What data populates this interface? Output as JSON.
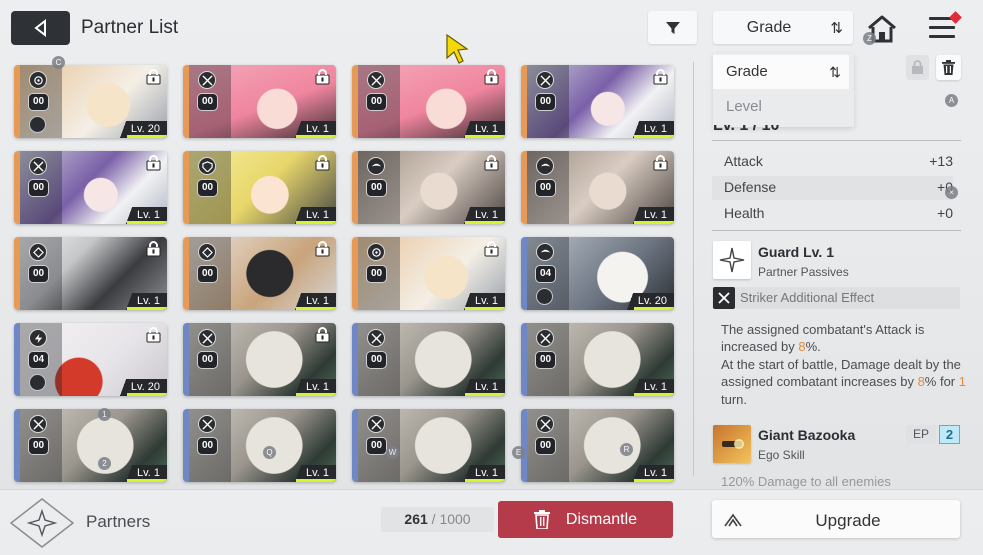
{
  "header": {
    "title": "Partner List",
    "sort_label": "Grade",
    "sort_arrows": "⇅",
    "hotkey_home": "Z"
  },
  "dropdown": {
    "options": [
      "Grade",
      "Level"
    ],
    "selected": "Grade",
    "hotkey": "A"
  },
  "grid": {
    "hotkey_top": "C",
    "cards": [
      {
        "count": "00",
        "level": "Lv. 20",
        "rarity": "orange",
        "type": "target",
        "art": "art1",
        "elem": true
      },
      {
        "count": "00",
        "level": "Lv. 1",
        "rarity": "orange",
        "type": "sword",
        "art": "art2",
        "elem": false
      },
      {
        "count": "00",
        "level": "Lv. 1",
        "rarity": "orange",
        "type": "sword",
        "art": "art2",
        "elem": false
      },
      {
        "count": "00",
        "level": "Lv. 1",
        "rarity": "orange",
        "type": "sword",
        "art": "art3",
        "elem": false
      },
      {
        "count": "00",
        "level": "Lv. 1",
        "rarity": "orange",
        "type": "sword",
        "art": "art3",
        "elem": false
      },
      {
        "count": "00",
        "level": "Lv. 1",
        "rarity": "orange",
        "type": "shield",
        "art": "art4",
        "elem": false
      },
      {
        "count": "00",
        "level": "Lv. 1",
        "rarity": "orange",
        "type": "wing",
        "art": "art5",
        "elem": false
      },
      {
        "count": "00",
        "level": "Lv. 1",
        "rarity": "orange",
        "type": "wing",
        "art": "art5",
        "elem": false
      },
      {
        "count": "00",
        "level": "Lv. 1",
        "rarity": "orange",
        "type": "diamond",
        "art": "art6",
        "elem": false
      },
      {
        "count": "00",
        "level": "Lv. 1",
        "rarity": "orange",
        "type": "diamond",
        "art": "art7",
        "elem": false
      },
      {
        "count": "00",
        "level": "Lv. 1",
        "rarity": "orange",
        "type": "target",
        "art": "art1",
        "elem": false
      },
      {
        "count": "04",
        "level": "Lv. 20",
        "rarity": "blue",
        "type": "wing",
        "art": "art8",
        "elem": true
      },
      {
        "count": "04",
        "level": "Lv. 20",
        "rarity": "blue",
        "type": "bolt",
        "art": "art9",
        "elem": true
      },
      {
        "count": "00",
        "level": "Lv. 1",
        "rarity": "blue",
        "type": "sword",
        "art": "art10",
        "elem": false
      },
      {
        "count": "00",
        "level": "Lv. 1",
        "rarity": "blue",
        "type": "sword",
        "art": "art10",
        "elem": false
      },
      {
        "count": "00",
        "level": "Lv. 1",
        "rarity": "blue",
        "type": "sword",
        "art": "art10",
        "elem": false
      },
      {
        "count": "00",
        "level": "Lv. 1",
        "rarity": "blue",
        "type": "sword",
        "art": "art10",
        "elem": false
      },
      {
        "count": "00",
        "level": "Lv. 1",
        "rarity": "blue",
        "type": "sword",
        "art": "art10",
        "elem": false
      },
      {
        "count": "00",
        "level": "Lv. 1",
        "rarity": "blue",
        "type": "sword",
        "art": "art10",
        "elem": false
      },
      {
        "count": "00",
        "level": "Lv. 1",
        "rarity": "blue",
        "type": "sword",
        "art": "art10",
        "elem": false
      }
    ],
    "locked": [
      true,
      true,
      true,
      true,
      true,
      true,
      true,
      true,
      true,
      true,
      true,
      false,
      true,
      true,
      false,
      false,
      false,
      false,
      false,
      false
    ],
    "hotkeys": [
      "1",
      "2",
      "Q",
      "W",
      "E",
      "R"
    ]
  },
  "detail": {
    "level_partial": "Lv. 1 / 10",
    "stats": [
      {
        "name": "Attack",
        "value": "+13"
      },
      {
        "name": "Defense",
        "value": "+0"
      },
      {
        "name": "Health",
        "value": "+0"
      }
    ],
    "passive": {
      "name": "Guard Lv. 1",
      "sub": "Partner Passives"
    },
    "striker": "Striker Additional Effect",
    "description": {
      "p1": "The assigned combatant's Attack is increased by ",
      "p1_val": "8",
      "p1_end": "%.",
      "p2": "At the start of battle, Damage dealt by the assigned combatant increases by ",
      "p2_val": "8",
      "p2_mid": "% for ",
      "p2_val2": "1",
      "p2_end": " turn."
    },
    "ego": {
      "name": "Giant Bazooka",
      "sub": "Ego Skill",
      "ep_label": "EP",
      "ep_value": "2"
    },
    "ego_desc_cut": "120% Damage to all enemies"
  },
  "footer": {
    "partners_label": "Partners",
    "capacity_current": "261",
    "capacity_sep": " / ",
    "capacity_max": "1000",
    "dismantle_label": "Dismantle",
    "upgrade_label": "Upgrade"
  },
  "colors": {
    "dismantle": "#b53a4a",
    "rarity_orange": "#e79a55",
    "rarity_blue": "#6f87c4",
    "level_bar": "#d5f52a",
    "highlight": "#e58a3a",
    "ep_value": "#47b6df"
  }
}
